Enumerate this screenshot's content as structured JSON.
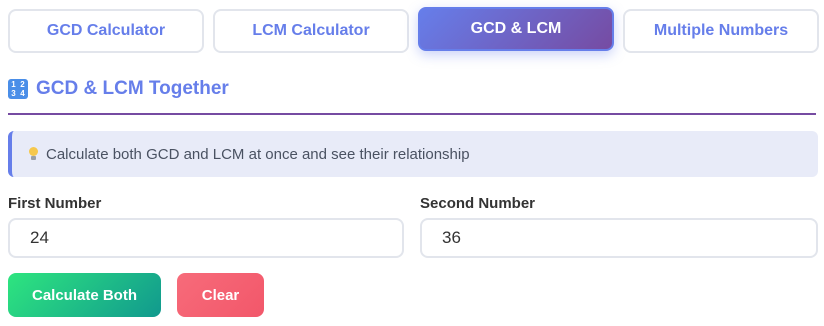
{
  "tabs": [
    {
      "label": "GCD Calculator",
      "active": false
    },
    {
      "label": "LCM Calculator",
      "active": false
    },
    {
      "label": "GCD & LCM",
      "active": true
    },
    {
      "label": "Multiple Numbers",
      "active": false
    }
  ],
  "section": {
    "title": "GCD & LCM Together",
    "icon": "numbers-1234-icon"
  },
  "info": {
    "icon": "lightbulb-icon",
    "text": "Calculate both GCD and LCM at once and see their relationship"
  },
  "form": {
    "first_label": "First Number",
    "first_value": "24",
    "second_label": "Second Number",
    "second_value": "36"
  },
  "buttons": {
    "calculate_label": "Calculate Both",
    "clear_label": "Clear"
  },
  "colors": {
    "accent": "#667eea",
    "accent_dark": "#764ba2",
    "calc_start": "#2ee57f",
    "calc_end": "#11998e",
    "clear": "#f2576a"
  }
}
